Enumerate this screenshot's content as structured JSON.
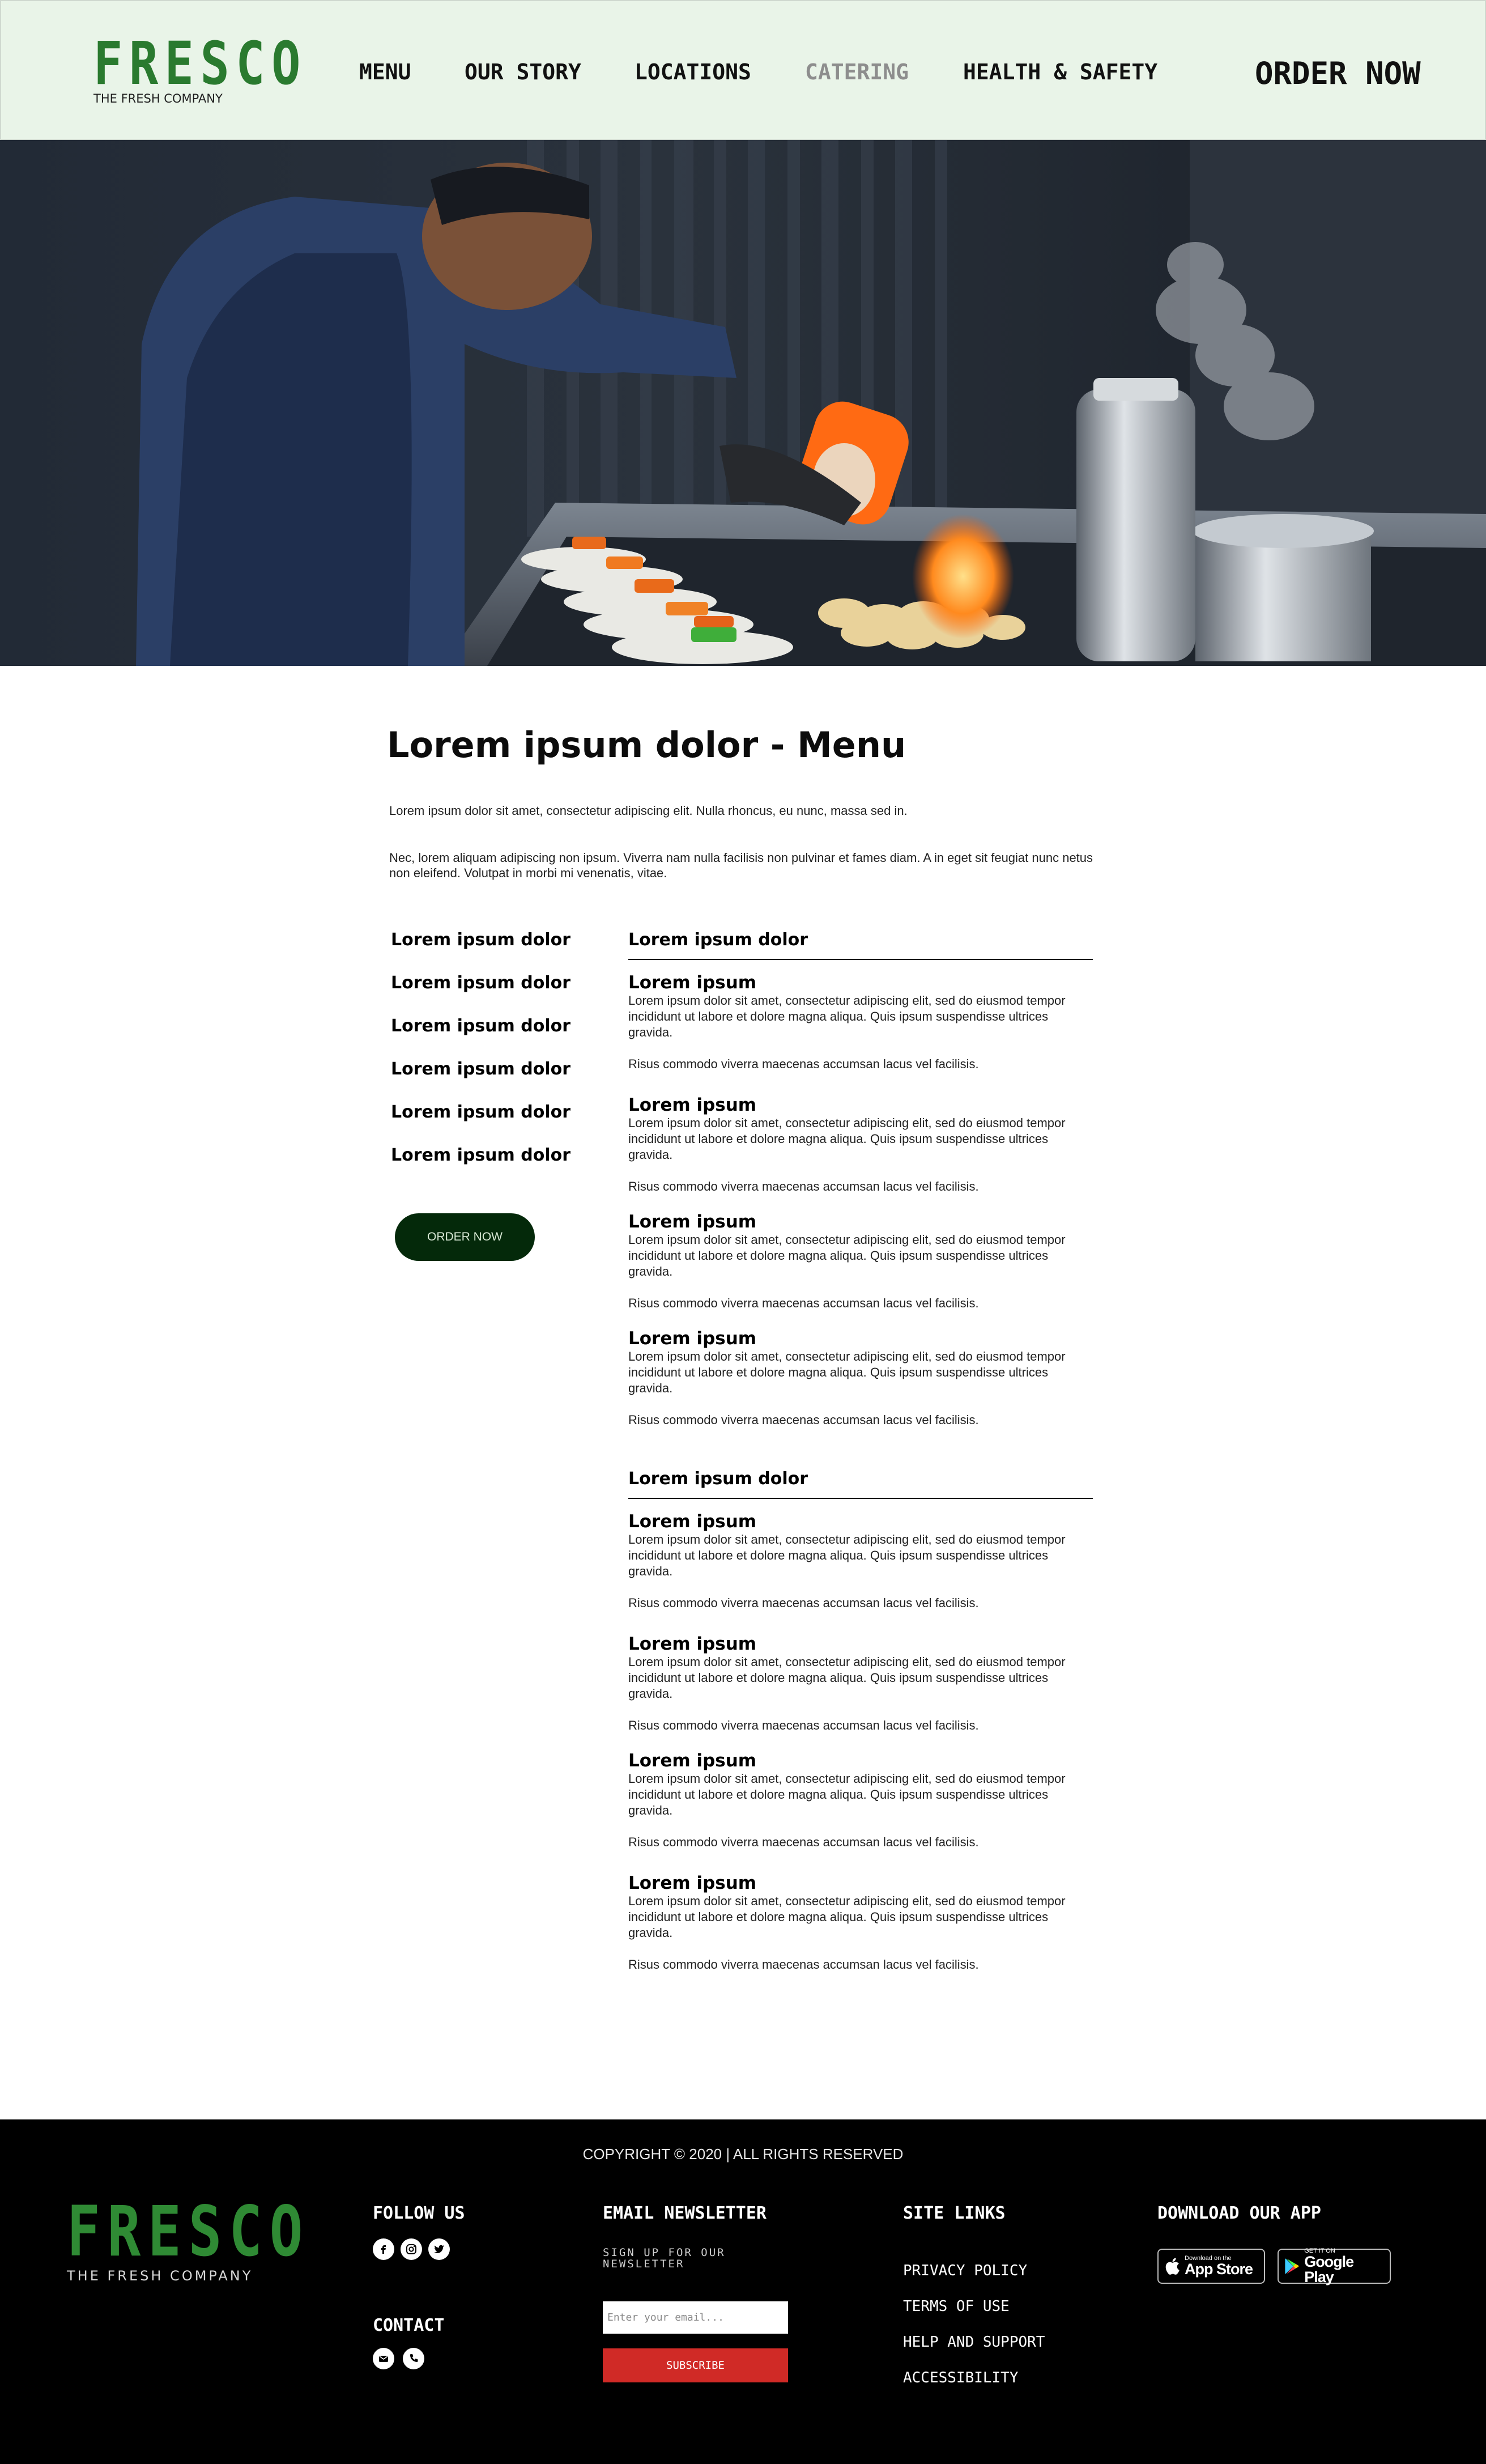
{
  "brand": {
    "name": "FRESCO",
    "tagline": "THE FRESH COMPANY",
    "green": "#2a7a2f"
  },
  "nav": {
    "items": [
      {
        "label": "MENU",
        "active": false
      },
      {
        "label": "OUR STORY",
        "active": false
      },
      {
        "label": "LOCATIONS",
        "active": false
      },
      {
        "label": "CATERING",
        "active": true
      },
      {
        "label": "HEALTH & SAFETY",
        "active": false
      }
    ],
    "order_label": "ORDER NOW"
  },
  "hero": {
    "image": "chef-torching-plated-dishes-photo"
  },
  "main": {
    "title": "Lorem ipsum dolor - Menu",
    "intro": [
      "Lorem ipsum dolor sit amet, consectetur adipiscing elit. Nulla rhoncus, eu nunc, massa sed in.",
      "Nec, lorem aliquam adipiscing non ipsum. Viverra nam nulla facilisis non pulvinar et fames diam. A in eget sit feugiat nunc netus non eleifend. Volutpat in morbi mi venenatis, vitae."
    ],
    "categories": [
      "Lorem ipsum dolor",
      "Lorem ipsum dolor",
      "Lorem ipsum dolor",
      "Lorem ipsum dolor",
      "Lorem ipsum  dolor",
      "Lorem ipsum dolor"
    ],
    "order_button": "ORDER NOW",
    "sections": [
      {
        "title": "Lorem ipsum dolor",
        "items": [
          {
            "name": "Lorem ipsum",
            "desc": "Lorem ipsum dolor sit amet, consectetur adipiscing elit, sed do eiusmod tempor incididunt ut labore et dolore magna aliqua. Quis ipsum suspendisse ultrices gravida.",
            "note": "Risus commodo viverra maecenas accumsan lacus vel facilisis."
          },
          {
            "name": "Lorem ipsum",
            "desc": "Lorem ipsum dolor sit amet, consectetur adipiscing elit, sed do eiusmod tempor incididunt ut labore et dolore magna aliqua. Quis ipsum suspendisse ultrices gravida.",
            "note": "Risus commodo viverra maecenas accumsan lacus vel facilisis."
          },
          {
            "name": "Lorem ipsum",
            "desc": "Lorem ipsum dolor sit amet, consectetur adipiscing elit, sed do eiusmod tempor incididunt ut labore et dolore magna aliqua. Quis ipsum suspendisse ultrices gravida.",
            "note": "Risus commodo viverra maecenas accumsan lacus vel facilisis."
          },
          {
            "name": "Lorem ipsum",
            "desc": "Lorem ipsum dolor sit amet, consectetur adipiscing elit, sed do eiusmod tempor incididunt ut labore et dolore magna aliqua. Quis ipsum suspendisse ultrices gravida.",
            "note": "Risus commodo viverra maecenas accumsan lacus vel facilisis."
          }
        ]
      },
      {
        "title": "Lorem ipsum dolor",
        "items": [
          {
            "name": "Lorem ipsum",
            "desc": "Lorem ipsum dolor sit amet, consectetur adipiscing elit, sed do eiusmod tempor incididunt ut labore et dolore magna aliqua. Quis ipsum suspendisse ultrices gravida.",
            "note": "Risus commodo viverra maecenas accumsan lacus vel facilisis."
          },
          {
            "name": "Lorem ipsum",
            "desc": "Lorem ipsum dolor sit amet, consectetur adipiscing elit, sed do eiusmod tempor incididunt ut labore et dolore magna aliqua. Quis ipsum suspendisse ultrices gravida.",
            "note": "Risus commodo viverra maecenas accumsan lacus vel facilisis."
          },
          {
            "name": "Lorem ipsum",
            "desc": "Lorem ipsum dolor sit amet, consectetur adipiscing elit, sed do eiusmod tempor incididunt ut labore et dolore magna aliqua. Quis ipsum suspendisse ultrices gravida.",
            "note": "Risus commodo viverra maecenas accumsan lacus vel facilisis."
          },
          {
            "name": "Lorem ipsum",
            "desc": "Lorem ipsum dolor sit amet, consectetur adipiscing elit, sed do eiusmod tempor incididunt ut labore et dolore magna aliqua. Quis ipsum suspendisse ultrices gravida.",
            "note": "Risus commodo viverra maecenas accumsan lacus vel facilisis."
          }
        ]
      }
    ]
  },
  "footer": {
    "follow_title": "FOLLOW US",
    "social_icons": [
      "facebook-icon",
      "instagram-icon",
      "twitter-icon"
    ],
    "contact_title": "CONTACT",
    "contact_icons": [
      "email-icon",
      "phone-icon"
    ],
    "newsletter": {
      "title": "EMAIL NEWSLETTER",
      "subtitle": "SIGN UP FOR OUR NEWSLETTER",
      "placeholder": "Enter your email...",
      "button": "SUBSCRIBE"
    },
    "links_title": "SITE LINKS",
    "links": [
      "PRIVACY POLICY",
      "TERMS OF USE",
      "HELP AND SUPPORT",
      "ACCESSIBILITY"
    ],
    "app_title": "DOWNLOAD OUR APP",
    "app_store": {
      "small": "Download on the",
      "big": "App Store"
    },
    "google_play": {
      "small": "GET IT ON",
      "big": "Google Play"
    },
    "copyright": "COPYRIGHT © 2020 | ALL RIGHTS RESERVED",
    "accent": "#d02a26"
  }
}
